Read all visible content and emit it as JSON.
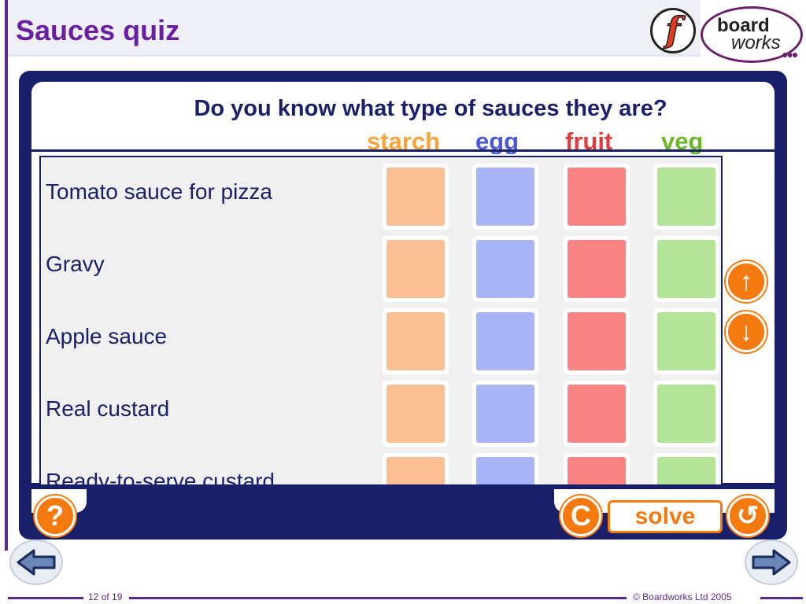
{
  "header": {
    "title": "Sauces quiz"
  },
  "logo": {
    "line1": "board",
    "line2": "works",
    "dots": "●●●"
  },
  "quiz": {
    "question": "Do you know what type of sauces they are?",
    "categories": [
      {
        "label": "starch",
        "color": "#f7a23a",
        "fill": "#fbbf93"
      },
      {
        "label": "egg",
        "color": "#4a5ad6",
        "fill": "#a8b4f6"
      },
      {
        "label": "fruit",
        "color": "#e33b3b",
        "fill": "#fb8585"
      },
      {
        "label": "veg",
        "color": "#6ab82a",
        "fill": "#b4e498"
      }
    ],
    "items": [
      {
        "label": "Tomato sauce for pizza"
      },
      {
        "label": "Gravy"
      },
      {
        "label": "Apple sauce"
      },
      {
        "label": "Real custard"
      },
      {
        "label": "Ready-to-serve custard"
      }
    ]
  },
  "controls": {
    "help_label": "?",
    "clear_label": "C",
    "solve_label": "solve",
    "reset_label": "↺",
    "scroll_up_label": "↑",
    "scroll_down_label": "↓"
  },
  "footer": {
    "page": "12 of 19",
    "copyright": "© Boardworks Ltd 2005"
  },
  "icons": {
    "help": "question-icon",
    "clear": "clear-icon",
    "reset": "reset-icon",
    "prev": "arrow-left-icon",
    "next": "arrow-right-icon"
  }
}
